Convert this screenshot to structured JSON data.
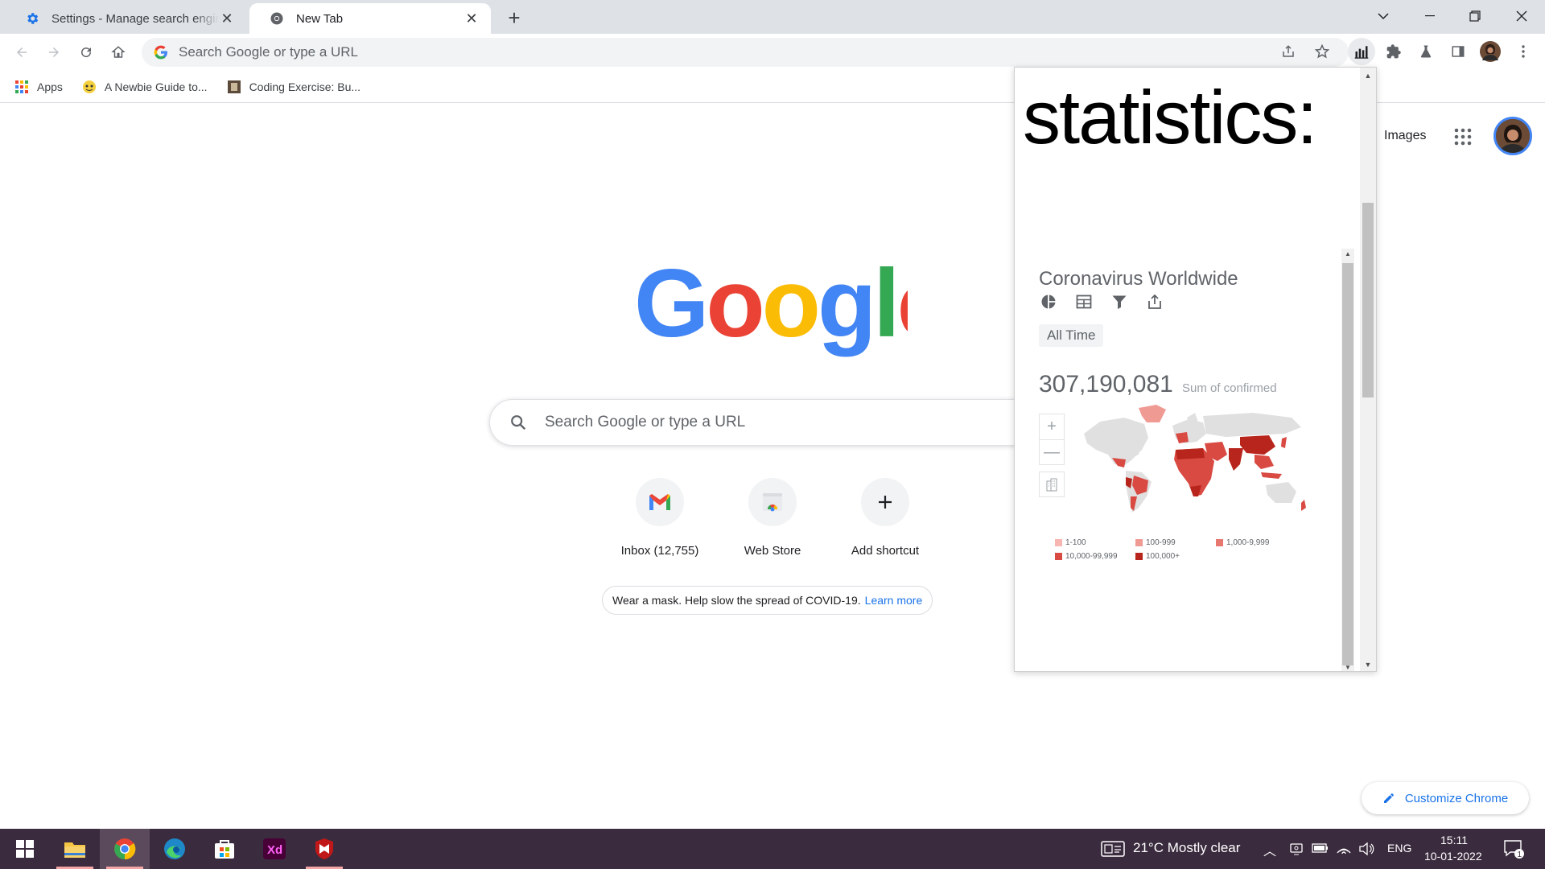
{
  "tabs": [
    {
      "title": "Settings - Manage search engines",
      "icon": "gear-icon",
      "active": false
    },
    {
      "title": "New Tab",
      "icon": "chrome-icon",
      "active": true
    }
  ],
  "omnibox": {
    "placeholder": "Search Google or type a URL"
  },
  "bookmarks": [
    {
      "label": "Apps",
      "icon": "apps-grid-icon"
    },
    {
      "label": "A Newbie Guide to...",
      "icon": "bookmark-favicon"
    },
    {
      "label": "Coding Exercise: Bu...",
      "icon": "bookmark-favicon"
    }
  ],
  "ntp": {
    "images_link": "Images",
    "search_placeholder": "Search Google or type a URL",
    "shortcuts": [
      {
        "label": "Inbox (12,755)",
        "icon": "gmail-icon"
      },
      {
        "label": "Web Store",
        "icon": "webstore-icon"
      },
      {
        "label": "Add shortcut",
        "icon": "plus-icon"
      }
    ],
    "promo_text": "Wear a mask. Help slow the spread of COVID-19.",
    "promo_link": "Learn more",
    "customize_label": "Customize Chrome"
  },
  "popup": {
    "title": "statistics:",
    "widget_title": "Coronavirus Worldwide",
    "time_filter": "All Time",
    "total_value": "307,190,081",
    "total_label": "Sum of confirmed",
    "zoom_in": "+",
    "zoom_out": "—",
    "legend": [
      {
        "label": "1-100",
        "color": "#f7b6b2"
      },
      {
        "label": "100-999",
        "color": "#f09a94"
      },
      {
        "label": "1,000-9,999",
        "color": "#e8786f"
      },
      {
        "label": "10,000-99,999",
        "color": "#d84a42"
      },
      {
        "label": "100,000+",
        "color": "#b8251d"
      }
    ]
  },
  "taskbar": {
    "weather": "21°C  Mostly clear",
    "language": "ENG",
    "time": "15:11",
    "date": "10-01-2022",
    "notifications": "1",
    "apps": [
      "start-icon",
      "file-explorer-icon",
      "chrome-icon",
      "edge-icon",
      "store-icon",
      "adobe-xd-icon",
      "mcafee-icon"
    ],
    "xd_label": "Xd"
  },
  "colors": {
    "accent": "#1a73e8",
    "tabstrip": "#dee1e6",
    "taskbar": "#3b2b3e"
  }
}
